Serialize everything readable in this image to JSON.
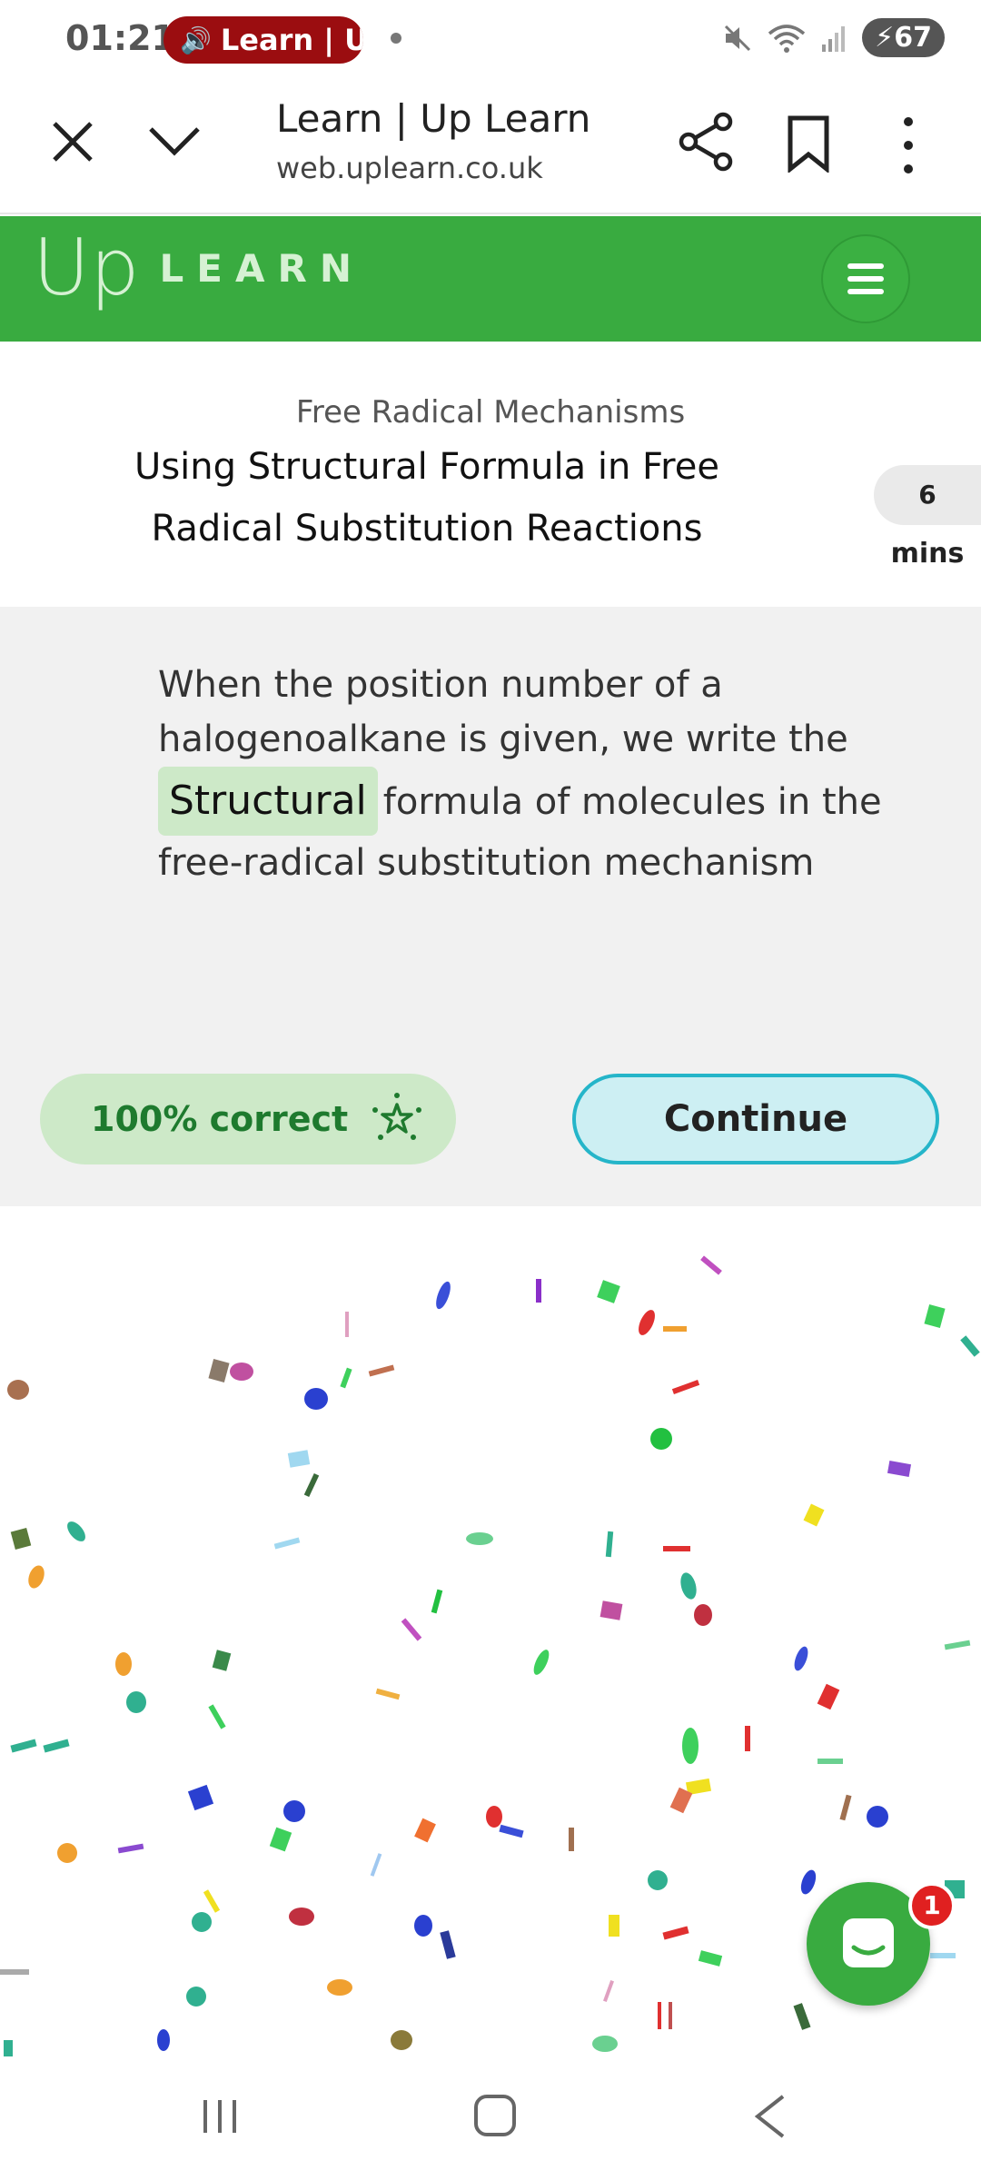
{
  "status_bar": {
    "time": "01:21",
    "media_pill_text": "Learn | U",
    "battery": "67"
  },
  "browser": {
    "title": "Learn | Up Learn",
    "url": "web.uplearn.co.uk"
  },
  "app_header": {
    "logo_up": "Up",
    "logo_learn": "LEARN",
    "brand_color": "#39ab40"
  },
  "lesson": {
    "topic": "Free Radical Mechanisms",
    "title": "Using Structural Formula in Free Radical Substitution Reactions",
    "minutes": "6",
    "minutes_label": "mins"
  },
  "question": {
    "text_before": "When the position number of a halogenoalkane is given, we write the",
    "answer": "Structural",
    "text_after": "formula of molecules in the free-radical substitution mechanism"
  },
  "result": {
    "score_label": "100% correct",
    "continue_label": "Continue"
  },
  "chat": {
    "badge_count": "1"
  }
}
